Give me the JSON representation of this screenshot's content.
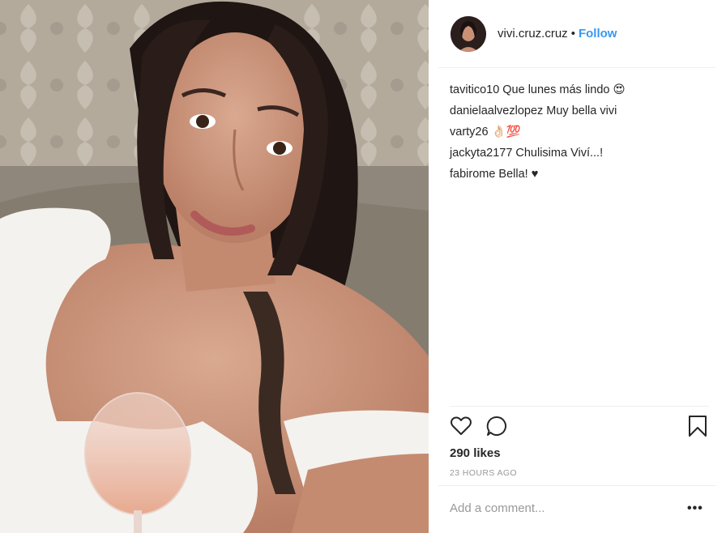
{
  "post": {
    "photo_icon": "selfie-photo",
    "header": {
      "username": "vivi.cruz.cruz",
      "separator": "•",
      "follow_label": "Follow"
    },
    "comments": [
      {
        "user": "tavitico10",
        "text": "Que lunes más lindo 😍"
      },
      {
        "user": "danielaalvezlopez",
        "text": "Muy bella vivi"
      },
      {
        "user": "varty26",
        "text": "👌🏻💯"
      },
      {
        "user": "jackyta2177",
        "text": "Chulisima Viví...!"
      },
      {
        "user": "fabirome",
        "text": "Bella! ♥"
      }
    ],
    "actions": {
      "like_icon": "heart-icon",
      "comment_icon": "comment-icon",
      "save_icon": "bookmark-icon"
    },
    "likes": "290 likes",
    "timestamp": "23 HOURS AGO",
    "add_comment_placeholder": "Add a comment...",
    "more_label": "•••"
  },
  "colors": {
    "link": "#3897f0",
    "text": "#262626",
    "muted": "#999999",
    "divider": "#efefef"
  }
}
